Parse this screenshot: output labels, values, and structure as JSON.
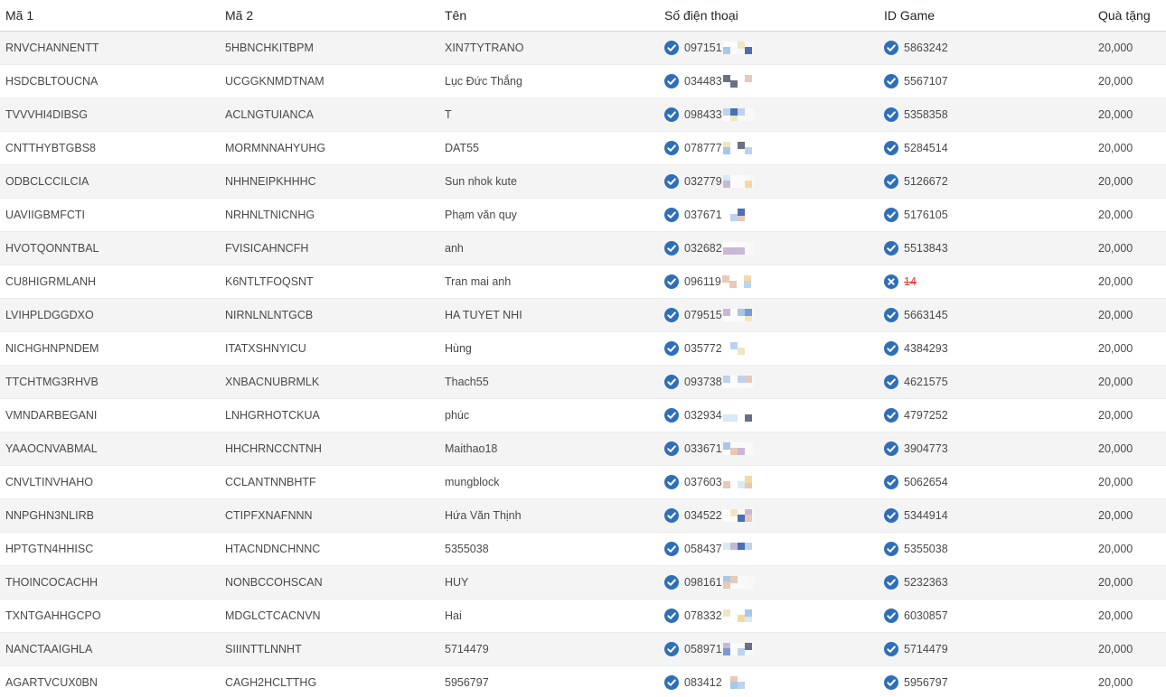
{
  "columns": {
    "ma1": "Mã 1",
    "ma2": "Mã 2",
    "ten": "Tên",
    "sdt": "Số điện thoại",
    "game_id": "ID Game",
    "gift": "Quà tặng"
  },
  "colors": {
    "check": "#2f6fb8",
    "invalid": "#e53935"
  },
  "icons": {
    "valid": "check-circle-icon",
    "invalid": "x-circle-icon"
  },
  "rows": [
    {
      "ma1": "RNVCHANNENTT",
      "ma2": "5HBNCHKITBPM",
      "ten": "XIN7TYTRANO",
      "phone": "097151",
      "phone_ok": true,
      "game_id": "5863242",
      "game_ok": true,
      "gift": "20,000"
    },
    {
      "ma1": "HSDCBLTOUCNA",
      "ma2": "UCGGKNMDTNAM",
      "ten": "Lục Đức Thắng",
      "phone": "034483",
      "phone_ok": true,
      "game_id": "5567107",
      "game_ok": true,
      "gift": "20,000"
    },
    {
      "ma1": "TVVVHI4DIBSG",
      "ma2": "ACLNGTUIANCA",
      "ten": "T",
      "phone": "098433",
      "phone_ok": true,
      "game_id": "5358358",
      "game_ok": true,
      "gift": "20,000"
    },
    {
      "ma1": "CNTTHYBTGBS8",
      "ma2": "MORMNNAHYUHG",
      "ten": "DAT55",
      "phone": "078777",
      "phone_ok": true,
      "game_id": "5284514",
      "game_ok": true,
      "gift": "20,000"
    },
    {
      "ma1": "ODBCLCCILCIA",
      "ma2": "NHHNEIPKHHHC",
      "ten": "Sun nhok kute",
      "phone": "032779",
      "phone_ok": true,
      "game_id": "5126672",
      "game_ok": true,
      "gift": "20,000"
    },
    {
      "ma1": "UAVIIGBMFCTI",
      "ma2": "NRHNLTNICNHG",
      "ten": "Phạm văn quy",
      "phone": "037671",
      "phone_ok": true,
      "game_id": "5176105",
      "game_ok": true,
      "gift": "20,000"
    },
    {
      "ma1": "HVOTQONNTBAL",
      "ma2": "FVISICAHNCFH",
      "ten": "anh",
      "phone": "032682",
      "phone_ok": true,
      "game_id": "5513843",
      "game_ok": true,
      "gift": "20,000"
    },
    {
      "ma1": "CU8HIGRMLANH",
      "ma2": "K6NTLTFOQSNT",
      "ten": "Tran mai anh",
      "phone": "096119",
      "phone_ok": true,
      "game_id": "14",
      "game_ok": false,
      "gift": "20,000"
    },
    {
      "ma1": "LVIHPLDGGDXO",
      "ma2": "NIRNLNLNTGCB",
      "ten": "HA TUYET NHI",
      "phone": "079515",
      "phone_ok": true,
      "game_id": "5663145",
      "game_ok": true,
      "gift": "20,000"
    },
    {
      "ma1": "NICHGHNPNDEM",
      "ma2": "ITATXSHNYICU",
      "ten": "Hùng",
      "phone": "035772",
      "phone_ok": true,
      "game_id": "4384293",
      "game_ok": true,
      "gift": "20,000"
    },
    {
      "ma1": "TTCHTMG3RHVB",
      "ma2": "XNBACNUBRMLK",
      "ten": "Thach55",
      "phone": "093738",
      "phone_ok": true,
      "game_id": "4621575",
      "game_ok": true,
      "gift": "20,000"
    },
    {
      "ma1": "VMNDARBEGANI",
      "ma2": "LNHGRHOTCKUA",
      "ten": "phúc",
      "phone": "032934",
      "phone_ok": true,
      "game_id": "4797252",
      "game_ok": true,
      "gift": "20,000"
    },
    {
      "ma1": "YAAOCNVABMAL",
      "ma2": "HHCHRNCCNTNH",
      "ten": "Maithao18",
      "phone": "033671",
      "phone_ok": true,
      "game_id": "3904773",
      "game_ok": true,
      "gift": "20,000"
    },
    {
      "ma1": "CNVLTINVHAHO",
      "ma2": "CCLANTNNBHTF",
      "ten": "mungblock",
      "phone": "037603",
      "phone_ok": true,
      "game_id": "5062654",
      "game_ok": true,
      "gift": "20,000"
    },
    {
      "ma1": "NNPGHN3NLIRB",
      "ma2": "CTIPFXNAFNNN",
      "ten": "Hứa Văn Thịnh",
      "phone": "034522",
      "phone_ok": true,
      "game_id": "5344914",
      "game_ok": true,
      "gift": "20,000"
    },
    {
      "ma1": "HPTGTN4HHISC",
      "ma2": "HTACNDNCHNNC",
      "ten": "5355038",
      "phone": "058437",
      "phone_ok": true,
      "game_id": "5355038",
      "game_ok": true,
      "gift": "20,000"
    },
    {
      "ma1": "THOINCOCACHH",
      "ma2": "NONBCCOHSCAN",
      "ten": "HUY",
      "phone": "098161",
      "phone_ok": true,
      "game_id": "5232363",
      "game_ok": true,
      "gift": "20,000"
    },
    {
      "ma1": "TXNTGAHHGCPO",
      "ma2": "MDGLCTCACNVN",
      "ten": "Hai",
      "phone": "078332",
      "phone_ok": true,
      "game_id": "6030857",
      "game_ok": true,
      "gift": "20,000"
    },
    {
      "ma1": "NANCTAAIGHLA",
      "ma2": "SIIINTTLNNHT",
      "ten": "5714479",
      "phone": "058971",
      "phone_ok": true,
      "game_id": "5714479",
      "game_ok": true,
      "gift": "20,000"
    },
    {
      "ma1": "AGARTVCUX0BN",
      "ma2": "CAGH2HCLTTHG",
      "ten": "5956797",
      "phone": "083412",
      "phone_ok": true,
      "game_id": "5956797",
      "game_ok": true,
      "gift": "20,000"
    }
  ]
}
